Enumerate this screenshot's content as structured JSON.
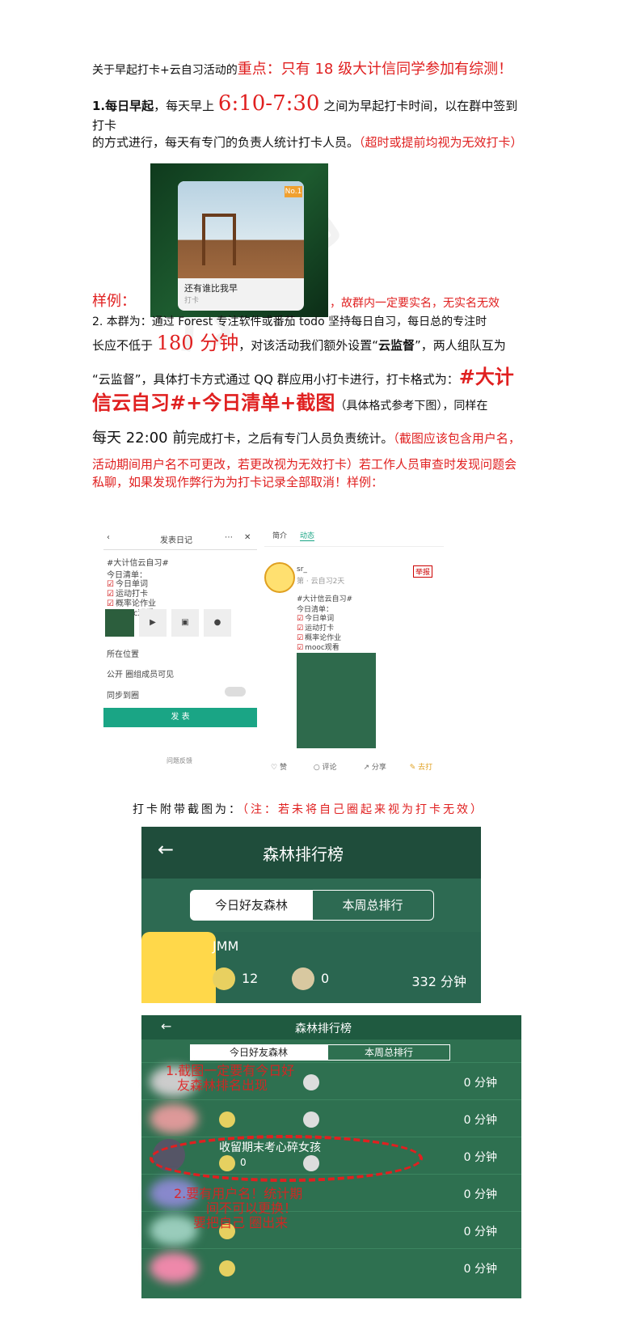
{
  "title": {
    "prefix": "关于早起打卡+云自习活动的",
    "emph": "重点：只有 18 级大计信同学参加有综测！"
  },
  "item1": {
    "label": "1.每日早起",
    "text1": "，每天早上 ",
    "time": "6:10-7:30",
    "text2": " 之间为早起打卡时间，以在群中签到打卡",
    "text3": "的方式进行，每天有专门的负责人统计打卡人员。",
    "note": "（超时或提前均视为无效打卡）"
  },
  "example1": {
    "label": "样例：",
    "card_caption": "还有谁比我早",
    "card_sub": "打卡",
    "badge": "No.1",
    "note": "，故群内一定要实名，无实名无效"
  },
  "item2": {
    "l1": "2. 本群为：通过 Forest 专注软件或番茄 todo 坚持每日自习，每日总的专注时",
    "l2a": "长应不低于 ",
    "minutes": "180 分钟",
    "l2b": "，对该活动我们额外设置“",
    "l2c": "云监督",
    "l2d": "”，两人组队互为",
    "l3a": "“云监督”，具体打卡方式通过 QQ 群应用小打卡进行，打卡格式为：",
    "fmt1": "#大计",
    "fmt2": "信云自习#+今日清单+截图",
    "l4b": "（具体格式参考下图），同样在",
    "l5a": "每天 22:00 前",
    "l5b": "完成打卡，之后有专门人员负责统计。",
    "l5c": "（截图应该包含用户名，",
    "l6": "活动期间用户名不可更改，若更改视为无效打卡）若工作人员审查时发现问题会",
    "l7": "私聊，如果发现作弊行为为打卡记录全部取消！样例："
  },
  "shotA": {
    "title": "发表日记",
    "tag": "#大计信云自习#",
    "list_title": "今日清单：",
    "items": [
      "今日单词",
      "运动打卡",
      "概率论作业",
      "mooc观看"
    ],
    "location": "所在位置",
    "visibility": "公开 圈组成员可见",
    "sync": "同步到圈",
    "publish": "发 表",
    "footer": "问题反馈"
  },
  "shotB": {
    "tab1": "简介",
    "tab2": "动态",
    "user": "sr_",
    "meta": "第  · 云自习2天",
    "tag": "#大计信云自习#",
    "list_title": "今日清单：",
    "items": [
      "今日单词",
      "运动打卡",
      "概率论作业",
      "mooc观看"
    ],
    "report": "举报",
    "like": "赞",
    "comment": "评论",
    "share": "分享",
    "punch": "去打"
  },
  "caption": {
    "text": "打卡附带截图为：",
    "note": "（注：若未将自己圈起来视为打卡无效）"
  },
  "lb1": {
    "title": "森林排行榜",
    "back": "←",
    "tab_today": "今日好友森林",
    "tab_week": "本周总排行",
    "user": "JMM",
    "count1": "12",
    "count2": "0",
    "minutes": "332 分钟"
  },
  "lb2": {
    "title": "森林排行榜",
    "back": "←",
    "tab_today": "今日好友森林",
    "tab_week": "本周总排行",
    "note1": "1.截图一定要有今日好",
    "note1b": "友森林排名出现",
    "note2": "2.要有用户名！统计期",
    "note2b": "间不可以更换！",
    "note2c": "要把自己 圈出来",
    "highlight_user": "收留期末考心碎女孩",
    "zero": "0",
    "minutes": "0 分钟"
  },
  "colors": {
    "accent_red": "#e02020",
    "forest_green": "#2d6a52",
    "teal_button": "#1aa585"
  }
}
